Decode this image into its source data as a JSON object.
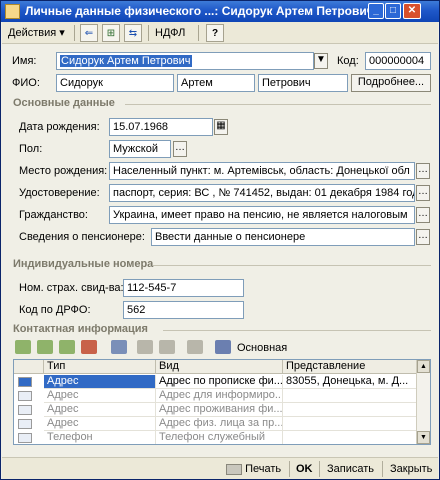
{
  "window": {
    "title": "Личные данные физического ...: Сидорук Артем Петрович"
  },
  "toolbar": {
    "actions_label": "Действия",
    "ndfl_label": "НДФЛ",
    "help_label": "?"
  },
  "header": {
    "name_label": "Имя:",
    "name_value": "Сидорук Артем Петрович",
    "code_label": "Код:",
    "code_value": "000000004",
    "fio_label": "ФИО:",
    "last_name": "Сидорук",
    "first_name": "Артем",
    "middle_name": "Петрович",
    "details_button": "Подробнее..."
  },
  "main_section": {
    "title": "Основные данные",
    "birth_date_label": "Дата рождения:",
    "birth_date_value": "15.07.1968",
    "gender_label": "Пол:",
    "gender_value": "Мужской",
    "birth_place_label": "Место рождения:",
    "birth_place_value": "Населенный пункт: м. Артемівськ, область: Донецької обл",
    "id_label": "Удостоверение:",
    "id_value": "паспорт, серия: ВС , № 741452, выдан: 01 декабря 1984 год",
    "citizenship_label": "Гражданство:",
    "citizenship_value": "Украина, имеет право на пенсию, не является налоговым",
    "pensioner_label": "Сведения о пенсионере:",
    "pensioner_value": "Ввести данные о пенсионере"
  },
  "ids_section": {
    "title": "Индивидуальные номера",
    "insurance_label": "Ном. страх. свид-ва:",
    "insurance_value": "112-545-7",
    "drfo_label": "Код по ДРФО:",
    "drfo_value": "562"
  },
  "contacts_section": {
    "title": "Контактная информация",
    "main_label": "Основная",
    "columns": [
      "Тип",
      "Вид",
      "Представление"
    ],
    "rows": [
      {
        "type": "Адрес",
        "kind": "Адрес по прописке фи...",
        "repr": "83055, Донецька, м. Д..."
      },
      {
        "type": "Адрес",
        "kind": "Адрес для информиро...",
        "repr": ""
      },
      {
        "type": "Адрес",
        "kind": "Адрес проживания фи...",
        "repr": ""
      },
      {
        "type": "Адрес",
        "kind": "Адрес физ. лица за пр...",
        "repr": ""
      },
      {
        "type": "Телефон",
        "kind": "Телефон служебный",
        "repr": ""
      }
    ]
  },
  "bottom": {
    "print_label": "Печать",
    "ok_label": "OK",
    "save_label": "Записать",
    "close_label": "Закрыть"
  },
  "colors": {
    "titlebar": "#1f58c9",
    "selection": "#316ac5",
    "window_bg": "#f0efe6"
  }
}
